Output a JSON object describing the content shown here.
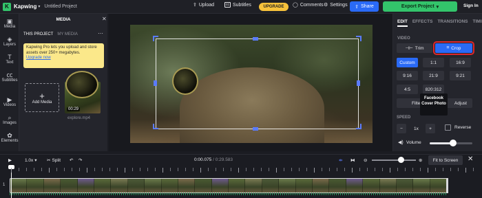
{
  "topbar": {
    "brand": "Kapwing",
    "project_name": "Untitled Project",
    "upload": "Upload",
    "subtitles": "Subtitles",
    "upgrade": "UPGRADE",
    "comments": "Comments",
    "settings": "Settings",
    "share": "Share",
    "export": "Export Project",
    "signin": "Sign In"
  },
  "rail": [
    {
      "icon": "media-icon",
      "label": "Media"
    },
    {
      "icon": "layers-icon",
      "label": "Layers"
    },
    {
      "icon": "text-icon",
      "label": "Text"
    },
    {
      "icon": "subtitles-icon",
      "label": "Subtitles"
    },
    {
      "icon": "videos-icon",
      "label": "Videos"
    },
    {
      "icon": "images-icon",
      "label": "Images"
    },
    {
      "icon": "elements-icon",
      "label": "Elements"
    }
  ],
  "media": {
    "title": "MEDIA",
    "tab_project": "THIS PROJECT",
    "tab_my_media": "MY MEDIA",
    "promo_text": "Kapwing Pro lets you upload and store assets over 250+ megabytes.",
    "promo_link": "Upgrade now",
    "add_media": "Add Media",
    "clip_duration": "00:29",
    "clip_name": "explore.mp4"
  },
  "right": {
    "tabs": [
      "EDIT",
      "EFFECTS",
      "TRANSITIONS",
      "TIMING"
    ],
    "video_label": "VIDEO",
    "trim": "Trim",
    "crop": "Crop",
    "ratios": [
      "Custom",
      "1:1",
      "16:9",
      "9:16",
      "21:9",
      "9:21",
      "4:5",
      "820:312"
    ],
    "filter": "Filter",
    "adjust": "Adjust",
    "tooltip": "Facebook Cover Photo",
    "speed_label": "SPEED",
    "speed_value": "1x",
    "minus": "−",
    "plus": "+",
    "reverse": "Reverse",
    "volume": "Volume",
    "volume_level": 0.55
  },
  "timeline": {
    "speed": "1.0x",
    "split": "Split",
    "current_time": "0:00.075",
    "separator": " / ",
    "total_time": "0:29.583",
    "fit": "Fit to Screen",
    "track_number": "1",
    "zoom_level": 0.6
  },
  "colors": {
    "accent_blue": "#2a6af6",
    "export_green": "#33c46b",
    "upgrade_yellow": "#f7c23b",
    "crop_highlight_red": "#e0262a"
  }
}
